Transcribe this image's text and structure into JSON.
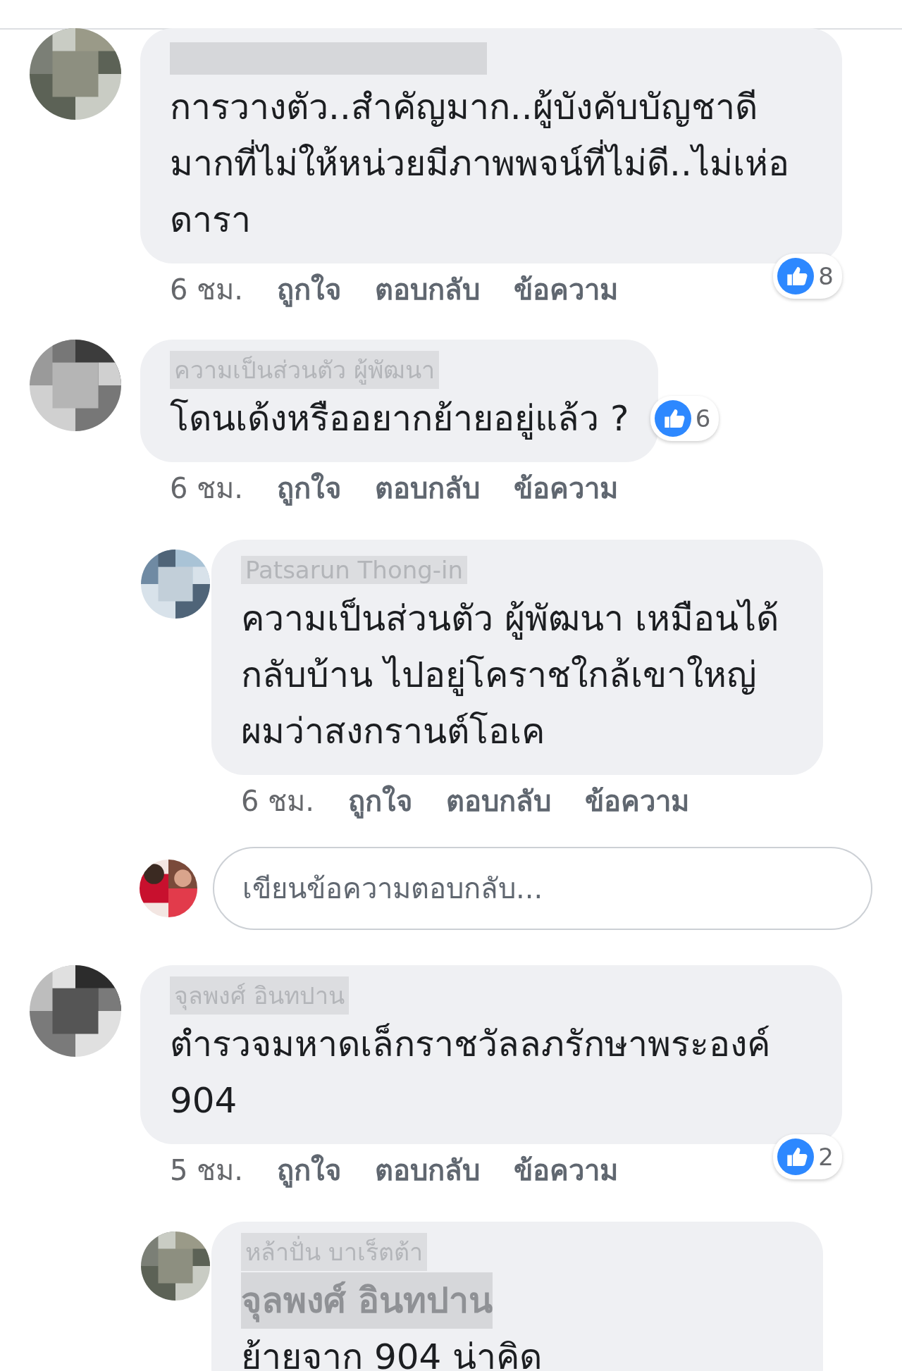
{
  "thread": [
    {
      "kind": "comment",
      "text": "การวางตัว..สำคัญมาก..ผู้บังคับบัญชาดีมากที่ไม่ให้หน่วยมีภาพพจน์ที่ไม่ดี..ไม่เห่อดารา",
      "time": "6 ชม.",
      "actions": [
        "ถูกใจ",
        "ตอบกลับ",
        "ข้อความ"
      ],
      "likes": "8",
      "reaction_beside": false
    },
    {
      "kind": "comment",
      "author": "ความเป็นส่วนตัว ผู้พัฒนา",
      "text": "โดนเด้งหรืออยากย้ายอยู่แล้ว ?",
      "time": "6 ชม.",
      "actions": [
        "ถูกใจ",
        "ตอบกลับ",
        "ข้อความ"
      ],
      "likes": "6",
      "reaction_beside": true
    },
    {
      "kind": "reply",
      "author": "Patsarun Thong-in",
      "text": "ความเป็นส่วนตัว ผู้พัฒนา เหมือนได้กลับบ้าน ไปอยู่โคราชใกล้เขาใหญ่ ผมว่าสงกรานต์โอเค",
      "time": "6 ชม.",
      "actions": [
        "ถูกใจ",
        "ตอบกลับ",
        "ข้อความ"
      ]
    },
    {
      "kind": "reply_box",
      "placeholder": "เขียนข้อความตอบกลับ..."
    },
    {
      "kind": "comment",
      "author": "จุลพงศ์ อินทปาน",
      "text": "ตำรวจมหาดเล็กราชวัลลภรักษาพระองค์ 904",
      "time": "5 ชม.",
      "actions": [
        "ถูกใจ",
        "ตอบกลับ",
        "ข้อความ"
      ],
      "likes": "2",
      "reaction_beside": false
    },
    {
      "kind": "reply",
      "author": "หล้าปั่น บาเร็ตต้า",
      "mention": "จุลพงศ์ อินทปาน",
      "text": "ย้ายจาก 904 น่าคิด"
    }
  ]
}
